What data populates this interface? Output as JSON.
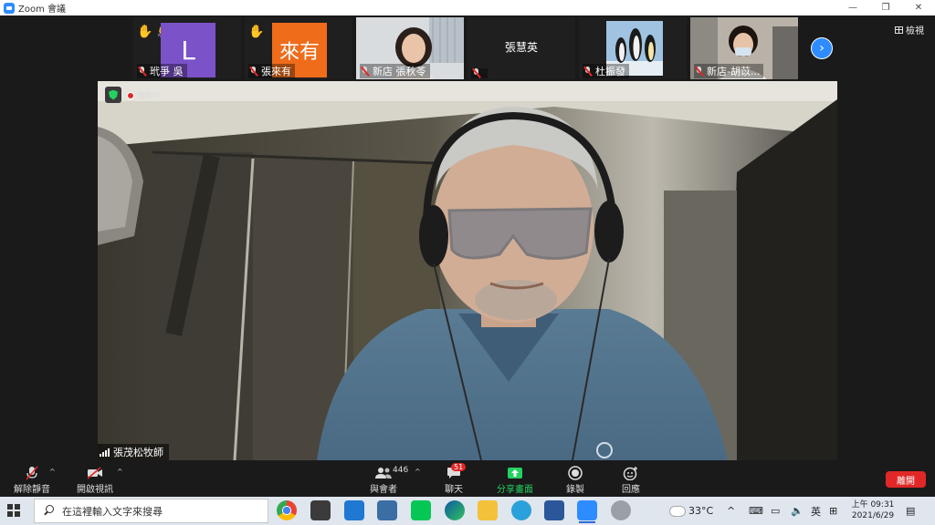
{
  "window": {
    "title": "Zoom 會議"
  },
  "thumbnails": [
    {
      "name": "玳爭 吳",
      "avatar_letter": "L",
      "avatar_color": "#7b52c8",
      "hands": "✋ 👏"
    },
    {
      "name": "張來有",
      "avatar_text": "來有",
      "avatar_color": "#ef6c1a",
      "hands": "✋"
    },
    {
      "name": "新店 張秋苓"
    },
    {
      "name": "",
      "center_name": "張慧英"
    },
    {
      "name": "杜振發"
    },
    {
      "name": "新店-胡苡..."
    }
  ],
  "view_button": {
    "label": "檢視"
  },
  "main_video": {
    "recording_label": "錄製中",
    "speaker_name": "張茂松牧師"
  },
  "toolbar": {
    "unmute": "解除靜音",
    "start_video": "開啟視訊",
    "participants": "與會者",
    "participants_count": "446",
    "chat": "聊天",
    "chat_badge": "51",
    "share": "分享畫面",
    "record": "錄製",
    "reactions": "回應",
    "leave": "離開"
  },
  "taskbar": {
    "search_placeholder": "在這裡輸入文字來搜尋",
    "weather": "33°C",
    "ime": "英",
    "time": "上午 09:31",
    "date": "2021/6/29"
  },
  "colors": {
    "zoom_blue": "#2D8CFF",
    "share_green": "#23d160",
    "leave_red": "#e02828"
  }
}
